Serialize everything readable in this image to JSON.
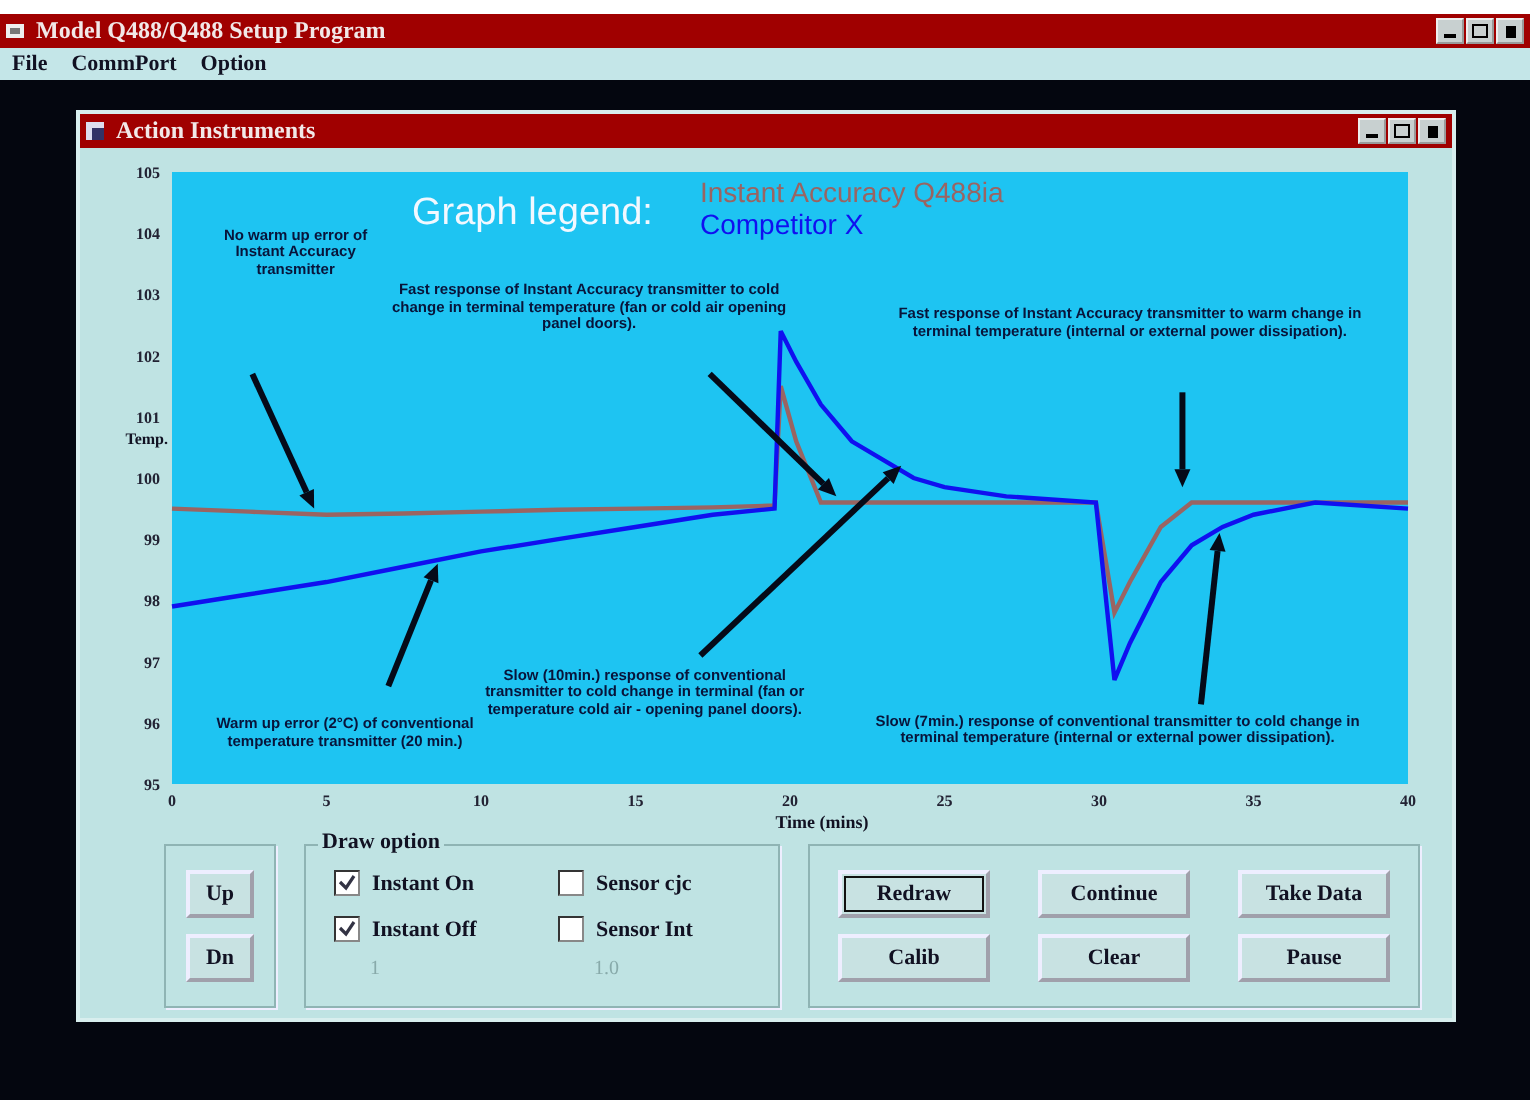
{
  "app_window": {
    "title": "Model Q488/Q488 Setup Program"
  },
  "menu": [
    "File",
    "CommPort",
    "Option"
  ],
  "inner_window": {
    "title": "Action Instruments"
  },
  "graph": {
    "legend_title": "Graph legend:",
    "chart_data": {
      "type": "line",
      "xlabel": "Time (mins)",
      "ylabel": "Temp.",
      "x": [
        0,
        2.5,
        5,
        7.5,
        10,
        12.5,
        15,
        17.5,
        19.5,
        19.7,
        20.2,
        21,
        22,
        23,
        24,
        25,
        27,
        29.9,
        30.5,
        31,
        32,
        33,
        34,
        35,
        37,
        40
      ],
      "series": [
        {
          "name": "Instant Accuracy Q488ia",
          "color": "#9a6462",
          "values": [
            99.5,
            99.45,
            99.4,
            99.42,
            99.45,
            99.48,
            99.5,
            99.52,
            99.55,
            101.5,
            100.6,
            99.6,
            99.6,
            99.6,
            99.6,
            99.6,
            99.6,
            99.6,
            97.8,
            98.3,
            99.2,
            99.6,
            99.6,
            99.6,
            99.6,
            99.6
          ]
        },
        {
          "name": "Competitor X",
          "color": "#1010f0",
          "values": [
            97.9,
            98.1,
            98.3,
            98.55,
            98.8,
            99.0,
            99.2,
            99.4,
            99.5,
            102.4,
            101.9,
            101.2,
            100.6,
            100.3,
            100.0,
            99.85,
            99.7,
            99.6,
            96.7,
            97.3,
            98.3,
            98.9,
            99.2,
            99.4,
            99.6,
            99.5
          ]
        }
      ],
      "xlim": [
        0,
        40
      ],
      "ylim": [
        95,
        105
      ],
      "xticks": [
        0,
        5,
        10,
        15,
        20,
        25,
        30,
        35,
        40
      ],
      "yticks": [
        95,
        96,
        97,
        98,
        99,
        100,
        101,
        102,
        103,
        104,
        105
      ],
      "annotations": [
        "No warm up error of Instant Accuracy transmitter",
        "Fast response of Instant Accuracy transmitter to cold change in terminal temperature (fan or cold air opening panel doors).",
        "Fast response of Instant Accuracy transmitter to warm change in terminal temperature (internal or external power dissipation).",
        "Warm up error (2°C) of conventional temperature transmitter (20 min.)",
        "Slow (10min.) response of conventional transmitter to cold change in terminal (fan or temperature cold air - opening panel doors).",
        "Slow (7min.) response of conventional transmitter to cold change in terminal temperature (internal or external power dissipation)."
      ]
    }
  },
  "scroll_buttons": [
    "Up",
    "Dn"
  ],
  "draw_option": {
    "title": "Draw option",
    "checkboxes": [
      {
        "label": "Instant On",
        "checked": true
      },
      {
        "label": "Sensor cjc",
        "checked": false
      },
      {
        "label": "Instant Off",
        "checked": true
      },
      {
        "label": "Sensor Int",
        "checked": false
      }
    ],
    "readouts": [
      "1",
      "1.0"
    ]
  },
  "buttons": [
    {
      "label": "Redraw",
      "default": true
    },
    {
      "label": "Continue",
      "default": false
    },
    {
      "label": "Take Data",
      "default": false
    },
    {
      "label": "Calib",
      "default": false
    },
    {
      "label": "Clear",
      "default": false
    },
    {
      "label": "Pause",
      "default": false
    }
  ]
}
